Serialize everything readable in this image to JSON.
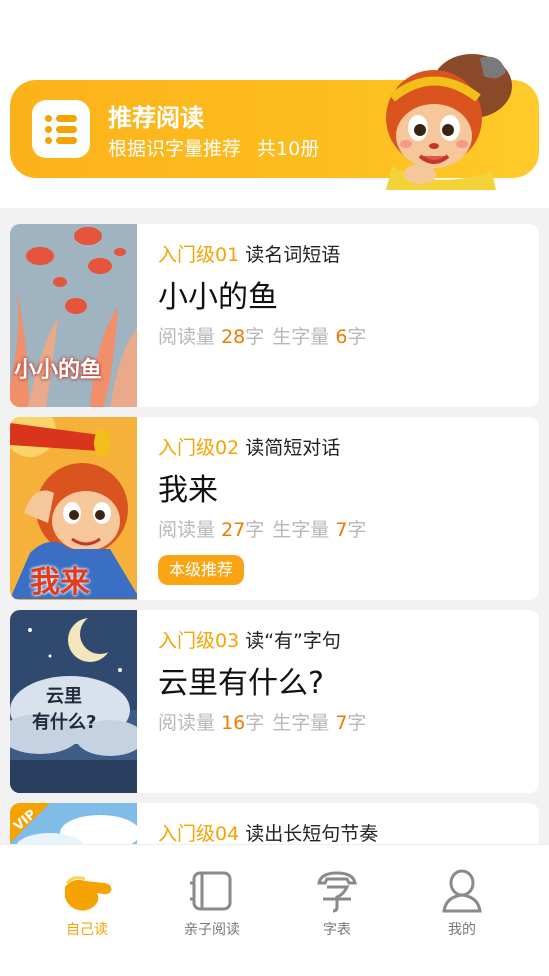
{
  "banner": {
    "title": "推荐阅读",
    "subtitle": "根据识字量推荐",
    "count": "共10册",
    "icon": "list-icon",
    "mascot": "monkey-king-mascot"
  },
  "labels": {
    "read_amount": "阅读量",
    "new_char_amount": "生字量",
    "char_unit": "字"
  },
  "books": [
    {
      "level": "入门级01",
      "theme": "读名词短语",
      "title": "小小的鱼",
      "read_count": "28",
      "new_count": "6",
      "cover_text": "小小的鱼",
      "badge": ""
    },
    {
      "level": "入门级02",
      "theme": "读简短对话",
      "title": "我来",
      "read_count": "27",
      "new_count": "7",
      "cover_text": "我来",
      "badge": "本级推荐"
    },
    {
      "level": "入门级03",
      "theme": "读“有”字句",
      "title": "云里有什么?",
      "read_count": "16",
      "new_count": "7",
      "cover_text_line1": "云里",
      "cover_text_line2": "有什么?",
      "badge": ""
    },
    {
      "level": "入门级04",
      "theme": "读出长短句节奏",
      "cover_badge": "VIP"
    }
  ],
  "nav": [
    {
      "label": "自己读",
      "icon": "hand-pointer-icon",
      "active": true
    },
    {
      "label": "亲子阅读",
      "icon": "book-icon",
      "active": false
    },
    {
      "label": "字表",
      "icon": "character-table-icon",
      "active": false
    },
    {
      "label": "我的",
      "icon": "person-icon",
      "active": false
    }
  ],
  "colors": {
    "accent": "#f5a300",
    "number": "#f07a00",
    "banner": "#fdbd1e"
  }
}
